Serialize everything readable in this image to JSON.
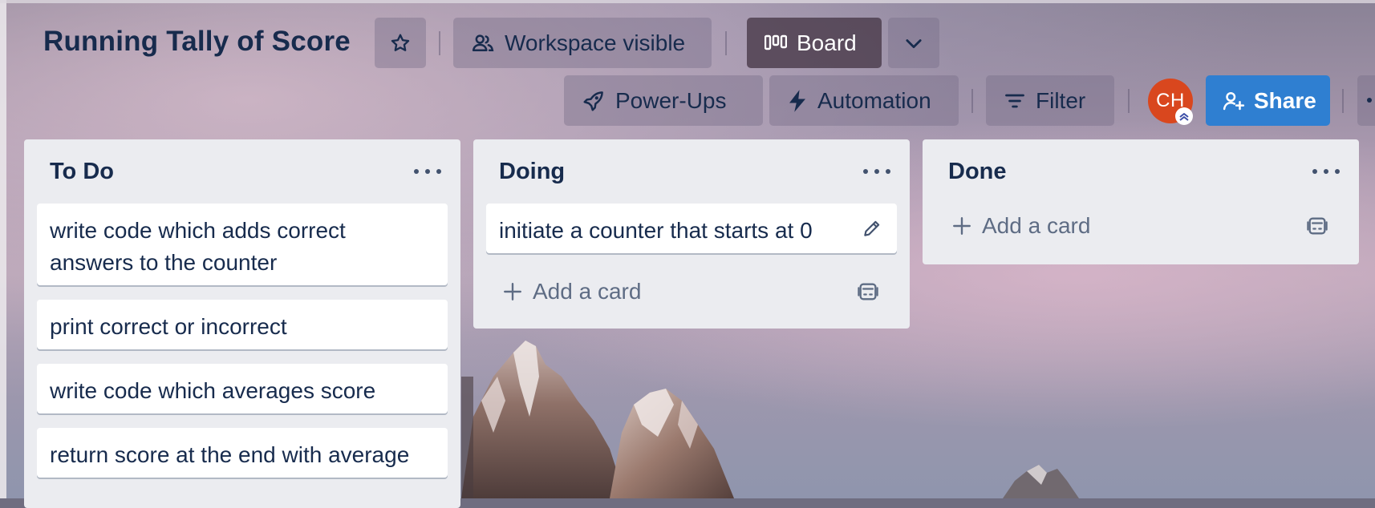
{
  "board": {
    "title": "Running Tally of Score",
    "visibility_label": "Workspace visible",
    "view_label": "Board"
  },
  "toolbar": {
    "powerups_label": "Power-Ups",
    "automation_label": "Automation",
    "filter_label": "Filter",
    "avatar_initials": "CH",
    "share_label": "Share"
  },
  "lists": [
    {
      "title": "To Do",
      "cards": [
        "write code which adds correct answers to the counter",
        "print correct or incorrect",
        "write code which averages score",
        "return score at the end with average"
      ]
    },
    {
      "title": "Doing",
      "cards": [
        "initiate a counter that starts at 0"
      ],
      "add_card_label": "Add a card"
    },
    {
      "title": "Done",
      "cards": [],
      "add_card_label": "Add a card"
    }
  ],
  "colors": {
    "accent": "#2f7fd1",
    "avatar": "#d9471e",
    "list_bg": "#ebecf0",
    "text": "#172b4d"
  },
  "icons": [
    "star-icon",
    "people-icon",
    "board-icon",
    "chevron-down-icon",
    "rocket-icon",
    "bolt-icon",
    "filter-icon",
    "add-person-icon",
    "ellipsis-icon",
    "plus-icon",
    "template-icon",
    "pencil-icon"
  ]
}
